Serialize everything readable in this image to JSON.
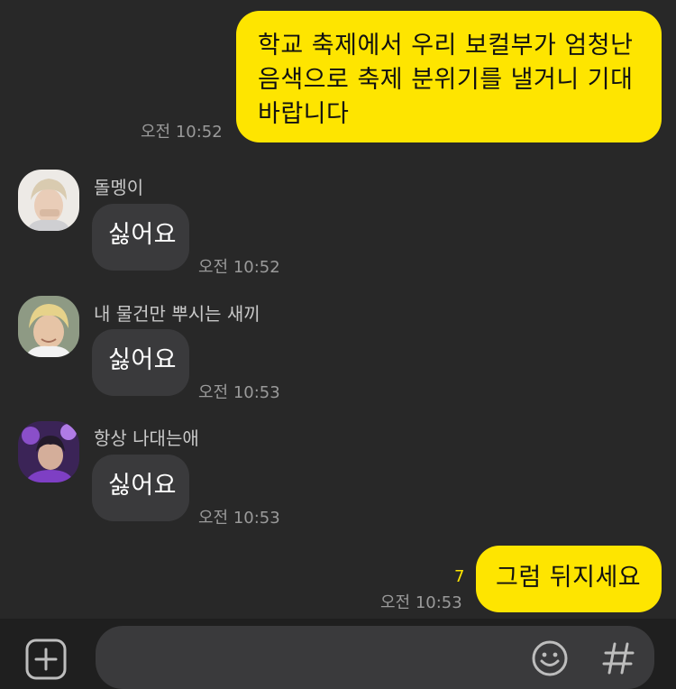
{
  "messages": {
    "m1": {
      "text": "학교 축제에서 우리 보컬부가 엄청난 음색으로 축제 분위기를 낼거니 기대 바랍니다",
      "time": "오전 10:52"
    },
    "m2": {
      "sender": "돌멩이",
      "text": "싫어요",
      "time": "오전 10:52"
    },
    "m3": {
      "sender": "내 물건만 뿌시는 새끼",
      "text": "싫어요",
      "time": "오전 10:53"
    },
    "m4": {
      "sender": "항상 나대는애",
      "text": "싫어요",
      "time": "오전 10:53"
    },
    "m5": {
      "text": "그럼 뒤지세요",
      "time": "오전 10:53",
      "unread": "7"
    }
  },
  "icons": {
    "add": "plus-square-icon",
    "emoji": "smiley-icon",
    "hashtag": "hashtag-icon"
  },
  "colors": {
    "background": "#282828",
    "my_bubble": "#FEE500",
    "other_bubble": "#3A3A3C",
    "unread": "#FEE500"
  }
}
